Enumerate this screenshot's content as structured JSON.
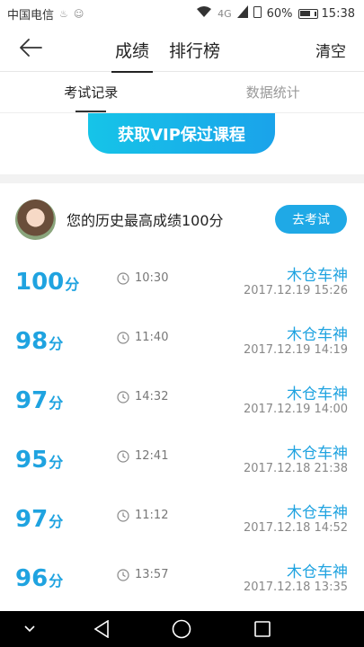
{
  "status_bar": {
    "carrier": "中国电信",
    "network": "4G",
    "battery": "60%",
    "time": "15:38"
  },
  "nav": {
    "back_icon": "arrow-left-icon",
    "tabs": [
      {
        "label": "成绩",
        "active": true
      },
      {
        "label": "排行榜",
        "active": false
      }
    ],
    "clear_label": "清空"
  },
  "subtabs": [
    {
      "label": "考试记录",
      "active": true
    },
    {
      "label": "数据统计",
      "active": false
    }
  ],
  "vip_button": "获取VIP保过课程",
  "best": {
    "text": "您的历史最高成绩100分",
    "button": "去考试"
  },
  "records": [
    {
      "score": "100",
      "unit": "分",
      "duration": "10:30",
      "name": "木仓车神",
      "date": "2017.12.19  15:26"
    },
    {
      "score": "98",
      "unit": "分",
      "duration": "11:40",
      "name": "木仓车神",
      "date": "2017.12.19  14:19"
    },
    {
      "score": "97",
      "unit": "分",
      "duration": "14:32",
      "name": "木仓车神",
      "date": "2017.12.19  14:00"
    },
    {
      "score": "95",
      "unit": "分",
      "duration": "12:41",
      "name": "木仓车神",
      "date": "2017.12.18  21:38"
    },
    {
      "score": "97",
      "unit": "分",
      "duration": "11:12",
      "name": "木仓车神",
      "date": "2017.12.18  14:52"
    },
    {
      "score": "96",
      "unit": "分",
      "duration": "13:57",
      "name": "木仓车神",
      "date": "2017.12.18  13:35"
    }
  ],
  "colors": {
    "accent": "#1fa3e0",
    "vip_gradient_start": "#16c4e8",
    "vip_gradient_end": "#1aa3ea"
  }
}
